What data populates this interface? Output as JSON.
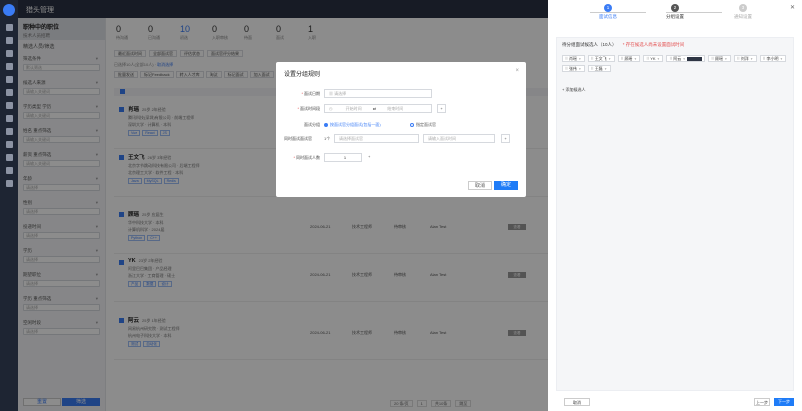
{
  "app": {
    "title": "猎头管理"
  },
  "job": {
    "title": "职种中的职位",
    "subtitle": "技术人员招聘"
  },
  "left_panel": {
    "header": "精选人员/筛选",
    "sections": [
      {
        "label": "筛选条件",
        "placeholder": "默认筛选"
      },
      {
        "label": "候选人来源",
        "placeholder": "请输入关键词"
      },
      {
        "label": "学历类型 学历",
        "placeholder": "请输入关键词"
      },
      {
        "label": "姓名 重点筛选",
        "placeholder": "请输入关键词"
      },
      {
        "label": "薪资 重点筛选",
        "placeholder": "请输入关键词"
      },
      {
        "label": "年龄",
        "placeholder": "请选择"
      },
      {
        "label": "性别",
        "placeholder": "请选择"
      },
      {
        "label": "投递时间",
        "placeholder": "请选择"
      },
      {
        "label": "学历",
        "placeholder": "请选择"
      },
      {
        "label": "期望职位",
        "placeholder": "请选择"
      },
      {
        "label": "学历 重点筛选",
        "placeholder": "请选择"
      },
      {
        "label": "空闲时段",
        "placeholder": "请选择"
      }
    ],
    "reset": "重置",
    "search": "筛选"
  },
  "stats": [
    {
      "n": "0",
      "l": "待沟通"
    },
    {
      "n": "0",
      "l": "已沟通"
    },
    {
      "n": "10",
      "l": "初选"
    },
    {
      "n": "0",
      "l": "入职审核"
    },
    {
      "n": "0",
      "l": "待面"
    },
    {
      "n": "0",
      "l": "面试"
    },
    {
      "n": "1",
      "l": "入职"
    }
  ],
  "filters": [
    "最近面试时间",
    "全部面试官",
    "评估状态",
    "面试官评分结果"
  ],
  "selection": {
    "text": "已选择10人(全部10人) ·",
    "link": "取消选择"
  },
  "actions": [
    "批量发送",
    "标记Feedback",
    "转入人才库",
    "淘汰",
    "标记面试",
    "加入面试"
  ],
  "candidates": [
    {
      "name": "肖瑶",
      "meta": "25岁 2年经验",
      "line1": "腾讯科技(深圳)有限公司 · 前端工程师",
      "line2": "深圳大学 · 计算机 · 本科",
      "tags": [
        "Vue",
        "React",
        "JS"
      ],
      "date": "2024-06-21",
      "pos": "技术工程师",
      "status": "待审核",
      "tag2": "Alan Test",
      "btn": "查看"
    },
    {
      "name": "王文飞",
      "meta": "26岁 3年经验",
      "line1": "北京字节跳动科技有限公司 · 后端工程师",
      "line2": "北京理工大学 · 软件工程 · 本科",
      "tags": [
        "Java",
        "MySQL",
        "Redis"
      ],
      "date": "2024-06-21",
      "pos": "技术工程师",
      "status": "待审核",
      "tag2": "Alan Test",
      "btn": "查看"
    },
    {
      "name": "顾瑶",
      "meta": "25岁 应届生",
      "line1": "华中科技大学 · 本科",
      "line2": "计算机科学 · 2024届",
      "tags": [
        "Python",
        "C++"
      ],
      "date": "2024-06-21",
      "pos": "技术工程师",
      "status": "待审核",
      "tag2": "Alan Test",
      "btn": "查看"
    },
    {
      "name": "YK",
      "meta": "23岁 2年经验",
      "line1": "阿里巴巴集团 · 产品经理",
      "line2": "浙江大学 · 工商管理 · 硕士",
      "tags": [
        "产品",
        "数据",
        "设计"
      ],
      "date": "2024-06-21",
      "pos": "技术工程师",
      "status": "待审核",
      "tag2": "Alan Test",
      "btn": "查看"
    },
    {
      "name": "阿云",
      "meta": "25岁 1年经验",
      "line1": "网易杭州研究院 · 测试工程师",
      "line2": "杭州电子科技大学 · 本科",
      "tags": [
        "测试",
        "自动化"
      ],
      "date": "2024-06-21",
      "pos": "技术工程师",
      "status": "待审核",
      "tag2": "Alan Test",
      "btn": "查看"
    }
  ],
  "pager": {
    "size": "20 条/页",
    "page": "1",
    "total": "共10条",
    "goto": "跳至"
  },
  "modal": {
    "title": "设置分组规则",
    "close": "×",
    "rows": [
      {
        "label": "面试日期",
        "value": "请选择"
      },
      {
        "label": "面试时间段",
        "from": "开始时间",
        "to": "结束时间"
      }
    ],
    "mode_label": "面试分组",
    "mode_on": "按面试官分组面试(包括一面)",
    "mode_off": "指定面试官",
    "interviewer_label": "同时面试面试官",
    "interviewer_count": "1个",
    "interviewer_a": "请选择面试官",
    "interviewer_b": "请输入面试时间",
    "per_label": "同时面试人数",
    "per_value": "1",
    "cancel": "取消",
    "ok": "确定"
  },
  "wizard": {
    "steps": [
      {
        "n": "1",
        "label": "面试信息"
      },
      {
        "n": "2",
        "label": "分组设置"
      },
      {
        "n": "3",
        "label": "通知设置"
      }
    ],
    "group_title": "待分组面试候选人（10人）",
    "warning": "* 存在候选人尚未设置面试时间",
    "chips": [
      "肖瑶",
      "王文飞",
      "顾瑶",
      "YK",
      "阿云",
      "顾瑶",
      "刘洋",
      "李小明",
      "张伟",
      "王磊"
    ],
    "add": "+ 添加候选人",
    "prev": "取消",
    "back": "上一步",
    "next": "下一步"
  }
}
